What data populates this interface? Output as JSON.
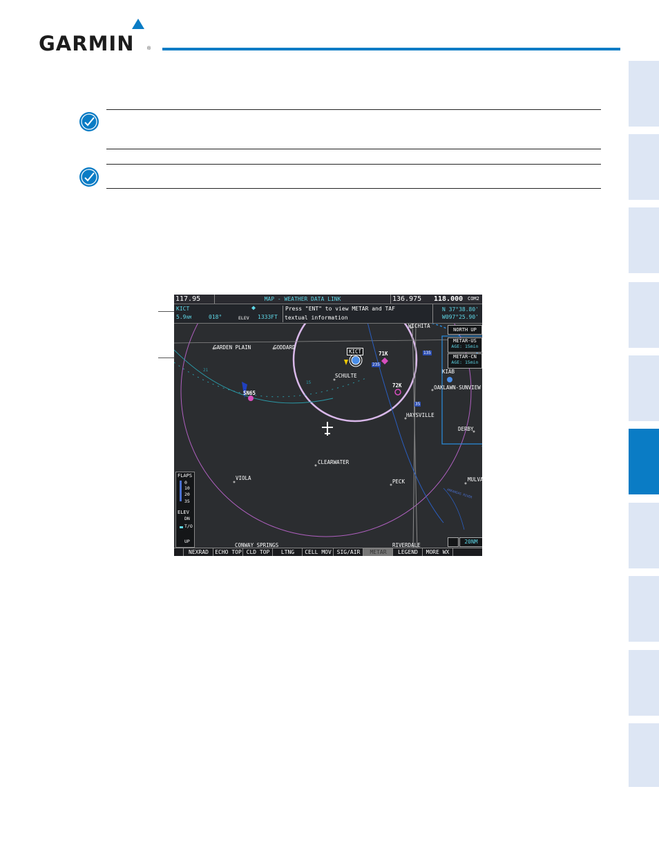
{
  "header": {
    "brand": "GARMIN",
    "registered": "®"
  },
  "nav_tabs": {
    "count": 10,
    "active_index": 5
  },
  "map": {
    "title_bar": {
      "freq_left": "117.95",
      "page_title": "MAP - WEATHER DATA LINK",
      "freq_standby": "136.975",
      "freq_active": "118.000",
      "com_label": "COM2"
    },
    "info_bar": {
      "waypoint": "KICT",
      "distance": "5.9",
      "distance_unit": "NM",
      "bearing": "018°",
      "elev_label": "ELEV",
      "elev_value": "1333FT",
      "prompt_line1": "Press \"ENT\" to view METAR and TAF",
      "prompt_line2": "textual information",
      "lat": "N 37°38.80'",
      "lon": "W097°25.90'"
    },
    "orientation": "NORTH UP",
    "metar_us": {
      "label": "METAR-US",
      "age": "AGE: 15min"
    },
    "metar_cn": {
      "label": "METAR-CN",
      "age": "AGE: 15min"
    },
    "places": {
      "wichita": "WICHITA",
      "garden_plain": "GARDEN PLAIN",
      "goddard": "GODDARD",
      "kict": "KICT",
      "k71": "71K",
      "k72": "72K",
      "schulte": "SCHULTE",
      "kiab": "KIAB",
      "oaklawn": "OAKLAWN-SUNVIEW",
      "sn65": "SN65",
      "haysville": "HAYSVILLE",
      "derby": "DERBY",
      "clearwater": "CLEARWATER",
      "viola": "VIOLA",
      "peck": "PECK",
      "mulvane": "MULVANE",
      "conway_springs": "CONWAY SPRINGS",
      "riverdale": "RIVERDALE",
      "arc_21": "21",
      "arc_15": "15",
      "hwy_135": "135",
      "hwy_235": "235",
      "hwy_35": "35",
      "river": "ARKANSAS RIVER"
    },
    "flaps": {
      "label": "FLAPS",
      "settings": [
        "0",
        "10",
        "20",
        "35"
      ],
      "elev_label": "ELEV",
      "dn": "DN",
      "to": "T/O",
      "up": "UP"
    },
    "range": "20NM",
    "softkeys": [
      "NEXRAD",
      "ECHO TOP",
      "CLD TOP",
      "LTNG",
      "CELL MOV",
      "SIG/AIR",
      "METAR",
      "LEGEND",
      "MORE WX"
    ],
    "colors": {
      "screen_bg": "#2b2d30",
      "cyan": "#5fd8e8",
      "range_ring": "#c9a6e2",
      "metar_marker": "#d84fbf",
      "accent": "#0a7cc5"
    }
  }
}
